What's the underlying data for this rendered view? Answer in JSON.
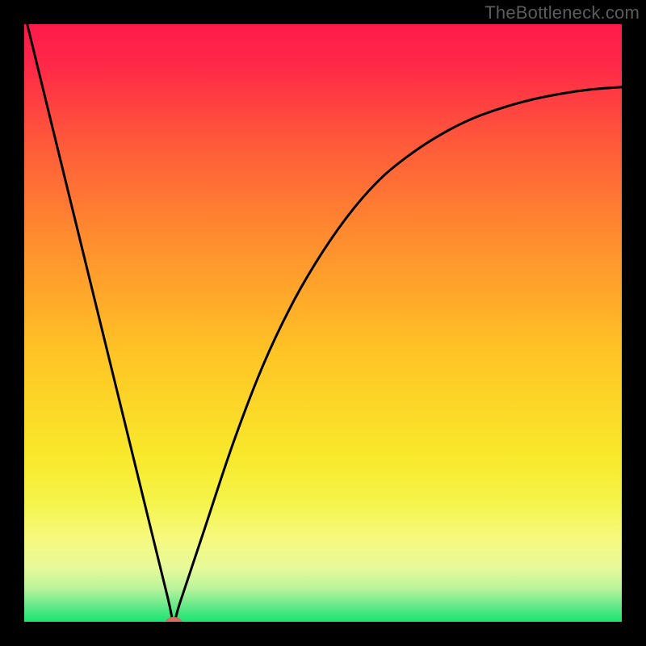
{
  "watermark": "TheBottleneck.com",
  "chart_data": {
    "type": "line",
    "title": "",
    "xlabel": "",
    "ylabel": "",
    "xlim": [
      0,
      100
    ],
    "ylim": [
      0,
      100
    ],
    "grid": false,
    "legend": false,
    "background_gradient": {
      "stops": [
        {
          "offset": 0.0,
          "color": "#ff1a4b"
        },
        {
          "offset": 0.07,
          "color": "#ff2948"
        },
        {
          "offset": 0.2,
          "color": "#ff5a3a"
        },
        {
          "offset": 0.35,
          "color": "#ff8a2f"
        },
        {
          "offset": 0.55,
          "color": "#ffc425"
        },
        {
          "offset": 0.72,
          "color": "#f8e82a"
        },
        {
          "offset": 0.8,
          "color": "#f4f44a"
        },
        {
          "offset": 0.86,
          "color": "#f6f97e"
        },
        {
          "offset": 0.91,
          "color": "#e7f99a"
        },
        {
          "offset": 0.945,
          "color": "#b8f39a"
        },
        {
          "offset": 0.975,
          "color": "#60e889"
        },
        {
          "offset": 1.0,
          "color": "#18e56f"
        }
      ]
    },
    "series": [
      {
        "name": "curve",
        "color": "#000000",
        "width": 3,
        "x": [
          0.5,
          5,
          10,
          15,
          20,
          24,
          25,
          26,
          30,
          35,
          40,
          45,
          50,
          55,
          60,
          65,
          70,
          75,
          80,
          85,
          90,
          95,
          100
        ],
        "y": [
          100,
          81.6,
          61.2,
          40.8,
          20.4,
          4.1,
          0,
          3,
          15,
          30,
          43,
          53.5,
          62,
          69,
          74.5,
          78.5,
          81.7,
          84.2,
          86,
          87.4,
          88.4,
          89.1,
          89.5
        ]
      }
    ],
    "marker": {
      "x": 25,
      "y": 0,
      "rx": 10,
      "ry": 6,
      "color": "#d86a62"
    }
  }
}
